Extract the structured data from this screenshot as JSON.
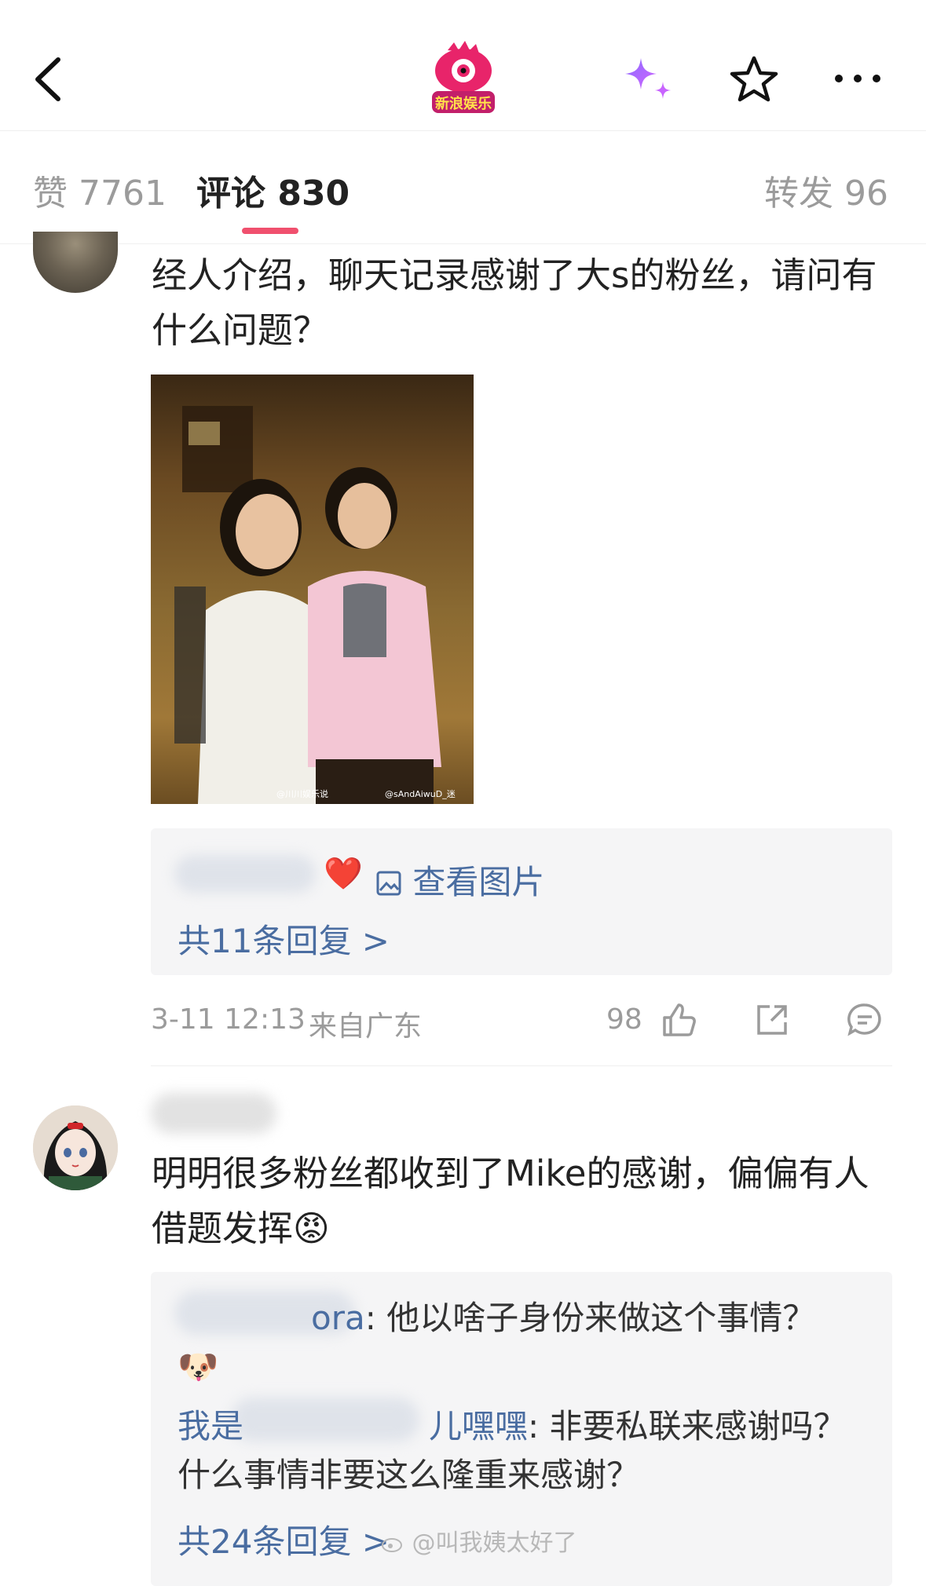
{
  "header": {
    "logo_text": "新浪娱乐",
    "icons": [
      "back-arrow-icon",
      "ai-sparkle-icon",
      "star-icon",
      "more-icon"
    ]
  },
  "tabs": {
    "like_label": "赞",
    "like_count": "7761",
    "comment_label": "评论",
    "comment_count": "830",
    "repost_label": "转发",
    "repost_count": "96"
  },
  "accent_color": "#f0506e",
  "link_color": "#4a6da1",
  "comments": [
    {
      "text": "经人介绍，聊天记录感谢了大s的粉丝，请问有什么问题？",
      "photo_watermarks": [
        "@川川娱乐说",
        "@sAndAiwuD_迷"
      ],
      "reply_preview_emoji": "❤️",
      "view_picture_label": "查看图片",
      "total_replies": "共11条回复 >",
      "time": "3-11 12:13",
      "location": "来自广东",
      "likes": "98"
    },
    {
      "text": "明明很多粉丝都收到了Mike的感谢，偏偏有人借题发挥😡",
      "replies": [
        {
          "name_visible": "ora",
          "text": ": 他以啥子身份来做这个事情？ 🐶"
        },
        {
          "name_visible_start": "我是",
          "name_visible_end": "儿嘿嘿",
          "text": ": 非要私联来感谢吗？什么事情非要这么隆重来感谢？"
        }
      ],
      "total_replies": "共24条回复 >"
    }
  ],
  "watermark": "@叫我姨太好了"
}
